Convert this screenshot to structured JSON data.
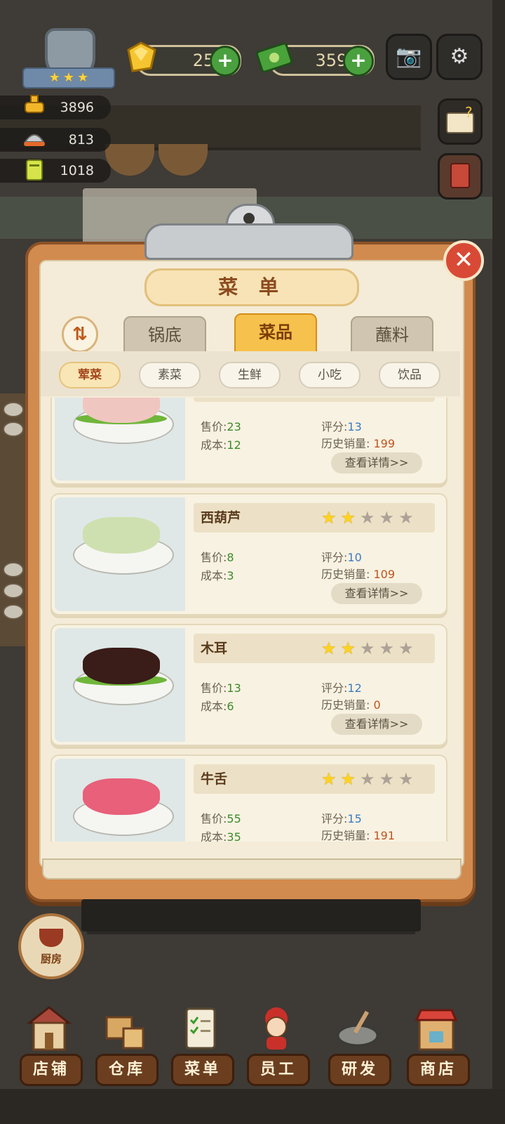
{
  "top": {
    "gems": "25",
    "cash": "3595"
  },
  "stats": [
    "3896",
    "813",
    "1018"
  ],
  "panel": {
    "title": "菜 单",
    "tabs": [
      "锅底",
      "菜品",
      "蘸料"
    ],
    "active_tab": "菜品",
    "subtabs": [
      "荤菜",
      "素菜",
      "生鲜",
      "小吃",
      "饮品"
    ],
    "active_subtab": "荤菜",
    "price_label": "售价",
    "cost_label": "成本",
    "score_label": "评分",
    "sales_label": "历史销量",
    "detail_button": "查看详情>>"
  },
  "dishes": [
    {
      "name": "",
      "price": "23",
      "cost": "12",
      "score": "13",
      "sales": "199",
      "stars": 2,
      "food_color": "#f0c6c0"
    },
    {
      "name": "西葫芦",
      "price": "8",
      "cost": "3",
      "score": "10",
      "sales": "109",
      "stars": 2,
      "food_color": "#cfe0b0"
    },
    {
      "name": "木耳",
      "price": "13",
      "cost": "6",
      "score": "12",
      "sales": "0",
      "stars": 2,
      "food_color": "#3a1c18"
    },
    {
      "name": "牛舌",
      "price": "55",
      "cost": "35",
      "score": "15",
      "sales": "191",
      "stars": 2,
      "food_color": "#e8607a"
    }
  ],
  "kitchen_label": "厨房",
  "nav": [
    "店铺",
    "仓库",
    "菜单",
    "员工",
    "研发",
    "商店"
  ],
  "colors": {
    "accent": "#f6c14c",
    "board": "#d28b4e",
    "close": "#d94a36",
    "star_on": "#ffd21f"
  }
}
